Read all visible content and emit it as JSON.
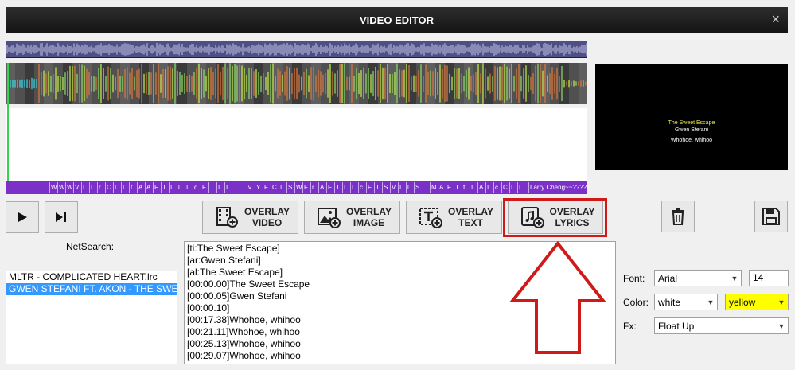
{
  "window": {
    "title": "VIDEO EDITOR",
    "close_glyph": "×"
  },
  "lyric_strip_labels": [
    "W",
    "W",
    "W",
    "V",
    "I",
    "I",
    "r",
    "C",
    "I",
    "I",
    "f",
    "A",
    "A",
    "F",
    "T",
    "I",
    "l",
    "I",
    "d",
    "F",
    "T",
    "I",
    "I",
    "v",
    "Y",
    "F",
    "C",
    "I",
    "S",
    "W",
    "F",
    "r",
    "A",
    "F",
    "T",
    "I",
    "I",
    "c",
    "F",
    "T",
    "S",
    "V",
    "I",
    "l",
    "S",
    "M",
    "A",
    "F",
    "T",
    "f",
    "I",
    "A",
    "I",
    "c",
    "C",
    "I",
    "I",
    "Larry Cheng~~????~~?"
  ],
  "preview": {
    "lines": [
      "The Sweet Escape",
      "Gwen Stefani",
      "Whohoe, whihoo"
    ],
    "title_color": "#e8e84a",
    "text_color": "#ffffff"
  },
  "controls": {
    "play_icon": "play-icon",
    "next_icon": "skip-forward-icon"
  },
  "overlay_buttons": [
    {
      "line1": "OVERLAY",
      "line2": "VIDEO",
      "icon": "film-add-icon"
    },
    {
      "line1": "OVERLAY",
      "line2": "IMAGE",
      "icon": "image-add-icon"
    },
    {
      "line1": "OVERLAY",
      "line2": "TEXT",
      "icon": "text-add-icon"
    },
    {
      "line1": "OVERLAY",
      "line2": "LYRICS",
      "icon": "music-add-icon"
    }
  ],
  "actions": {
    "delete_icon": "trash-icon",
    "save_icon": "save-icon"
  },
  "netsearch": {
    "label": "NetSearch:"
  },
  "files": [
    {
      "name": "MLTR - COMPLICATED HEART.lrc",
      "selected": false
    },
    {
      "name": "GWEN STEFANI FT. AKON - THE SWEET ESCAPE.lrc",
      "selected": true
    }
  ],
  "lyrics_lines": [
    "[ti:The Sweet Escape]",
    "[ar:Gwen Stefani]",
    "[al:The Sweet Escape]",
    "[00:00.00]The Sweet Escape",
    "[00:00.05]Gwen Stefani",
    "[00:00.10]",
    "[00:17.38]Whohoe, whihoo",
    "[00:21.11]Whohoe, whihoo",
    "[00:25.13]Whohoe, whihoo",
    "[00:29.07]Whohoe, whihoo"
  ],
  "props": {
    "font_label": "Font:",
    "font_value": "Arial",
    "size_value": "14",
    "color_label": "Color:",
    "color_value": "white",
    "color2_value": "yellow",
    "fx_label": "Fx:",
    "fx_value": "Float Up"
  },
  "colors": {
    "accent_highlight": "#d01919",
    "lyric_strip": "#7b30c7",
    "list_selection": "#3399ff",
    "color_dropdown_bg": "#ffff00"
  }
}
